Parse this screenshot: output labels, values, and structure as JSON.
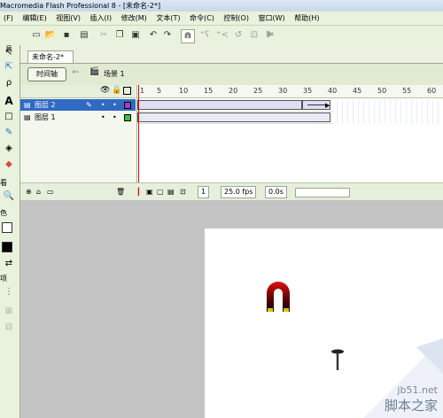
{
  "app": {
    "title": "Macromedia Flash Professional 8 - [未命名-2*]"
  },
  "menu": [
    "(F)",
    "编辑(E)",
    "视图(V)",
    "插入(I)",
    "修改(M)",
    "文本(T)",
    "命令(C)",
    "控制(O)",
    "窗口(W)",
    "帮助(H)"
  ],
  "tools": {
    "section_view": "看",
    "section_colors": "色",
    "section_options": "项"
  },
  "document": {
    "tab": "未命名-2*",
    "timeline_button": "时间轴",
    "scene": "场景 1"
  },
  "timeline": {
    "ticks": [
      "1",
      "5",
      "10",
      "15",
      "20",
      "25",
      "30",
      "35",
      "40",
      "45",
      "50",
      "55",
      "60"
    ],
    "layers": [
      {
        "name": "图层 2",
        "selected": true,
        "color": "#a040c0"
      },
      {
        "name": "图层 1",
        "selected": false,
        "color": "#40c040"
      }
    ],
    "current_frame": "1",
    "fps": "25.0 fps",
    "time": "0.0s"
  },
  "watermark": {
    "site": "jb51.net",
    "brand": "脚本之家"
  },
  "colors": {
    "accent": "#316ac5",
    "playhead": "#e00000",
    "magnet_red": "#c01010"
  }
}
